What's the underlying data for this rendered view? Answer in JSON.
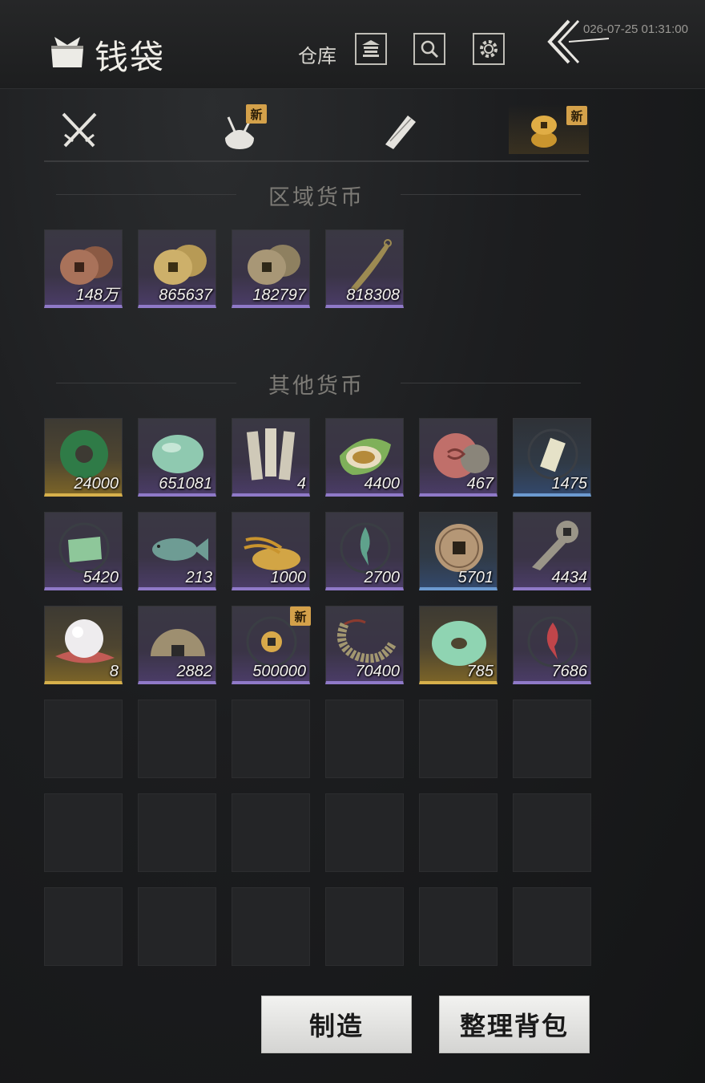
{
  "header": {
    "title": "钱袋",
    "warehouse_label": "仓库",
    "timestamp": "026-07-25 01:31:00"
  },
  "tabs": [
    {
      "name": "weapons",
      "icon": "crossed-swords-icon",
      "new_badge": ""
    },
    {
      "name": "bundle",
      "icon": "cloth-bundle-icon",
      "new_badge": "新"
    },
    {
      "name": "scrolls",
      "icon": "scroll-icon",
      "new_badge": ""
    },
    {
      "name": "currency",
      "icon": "coins-icon",
      "new_badge": "新",
      "active": true
    }
  ],
  "sections": {
    "regional": "区域货币",
    "other": "其他货币"
  },
  "regional_items": [
    {
      "qty": "148万",
      "rarity": "purple",
      "icon": "copper-coin-stack-icon"
    },
    {
      "qty": "865637",
      "rarity": "purple",
      "icon": "gold-coin-stack-icon"
    },
    {
      "qty": "182797",
      "rarity": "purple",
      "icon": "bronze-coin-stack-icon"
    },
    {
      "qty": "818308",
      "rarity": "purple",
      "icon": "knife-coin-icon"
    }
  ],
  "other_items": [
    {
      "qty": "24000",
      "rarity": "gold",
      "icon": "jade-bi-disc-icon",
      "new_badge": ""
    },
    {
      "qty": "651081",
      "rarity": "purple",
      "icon": "jade-stone-icon",
      "new_badge": ""
    },
    {
      "qty": "4",
      "rarity": "purple",
      "icon": "bamboo-slips-icon",
      "new_badge": ""
    },
    {
      "qty": "4400",
      "rarity": "purple",
      "icon": "melon-icon",
      "new_badge": ""
    },
    {
      "qty": "467",
      "rarity": "purple",
      "icon": "pink-seal-stone-icon",
      "new_badge": ""
    },
    {
      "qty": "1475",
      "rarity": "blue",
      "icon": "token-plate-icon",
      "new_badge": ""
    },
    {
      "qty": "5420",
      "rarity": "purple",
      "icon": "map-scrap-icon",
      "new_badge": ""
    },
    {
      "qty": "213",
      "rarity": "purple",
      "icon": "fish-icon",
      "new_badge": ""
    },
    {
      "qty": "1000",
      "rarity": "purple",
      "icon": "grain-pile-icon",
      "new_badge": ""
    },
    {
      "qty": "2700",
      "rarity": "purple",
      "icon": "green-flame-sigil-icon",
      "new_badge": ""
    },
    {
      "qty": "5701",
      "rarity": "blue",
      "icon": "ancient-coin-icon",
      "new_badge": ""
    },
    {
      "qty": "4434",
      "rarity": "purple",
      "icon": "key-coin-icon",
      "new_badge": ""
    },
    {
      "qty": "8",
      "rarity": "gold",
      "icon": "pearl-icon",
      "new_badge": ""
    },
    {
      "qty": "2882",
      "rarity": "purple",
      "icon": "half-coin-icon",
      "new_badge": ""
    },
    {
      "qty": "500000",
      "rarity": "purple",
      "icon": "gold-square-coin-icon",
      "new_badge": "新"
    },
    {
      "qty": "70400",
      "rarity": "purple",
      "icon": "coin-string-icon",
      "new_badge": ""
    },
    {
      "qty": "785",
      "rarity": "gold",
      "icon": "jade-ring-icon",
      "new_badge": ""
    },
    {
      "qty": "7686",
      "rarity": "purple",
      "icon": "red-flame-sigil-icon",
      "new_badge": ""
    }
  ],
  "buttons": {
    "craft": "制造",
    "sort": "整理背包"
  },
  "colors": {
    "gold_rarity": "#d7b04b",
    "purple_rarity": "#8f79c8",
    "blue_rarity": "#6c9ad0",
    "new_badge": "#d4a14a"
  }
}
